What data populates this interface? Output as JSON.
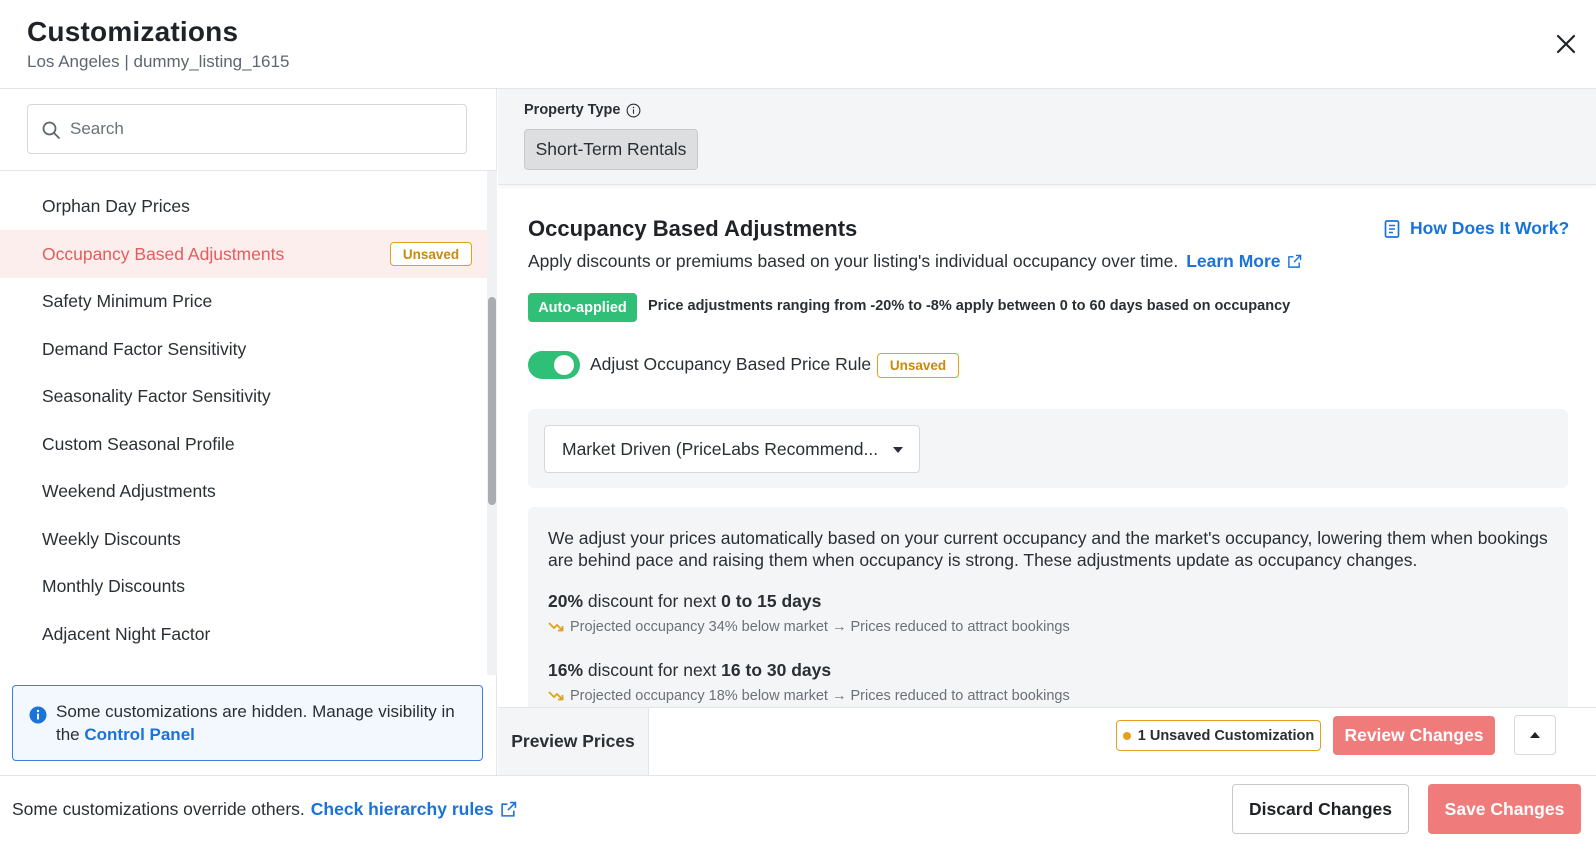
{
  "header": {
    "title": "Customizations",
    "subtitle": "Los Angeles | dummy_listing_1615"
  },
  "search": {
    "placeholder": "Search",
    "value": ""
  },
  "sidebar": {
    "items": [
      {
        "label": "Orphan Day Prices"
      },
      {
        "label": "Occupancy Based Adjustments",
        "badge": "Unsaved",
        "active": true
      },
      {
        "label": "Safety Minimum Price"
      },
      {
        "label": "Demand Factor Sensitivity"
      },
      {
        "label": "Seasonality Factor Sensitivity"
      },
      {
        "label": "Custom Seasonal Profile"
      },
      {
        "label": "Weekend Adjustments"
      },
      {
        "label": "Weekly Discounts"
      },
      {
        "label": "Monthly Discounts"
      },
      {
        "label": "Adjacent Night Factor"
      }
    ],
    "info": {
      "text": "Some customizations are hidden. Manage visibility in the ",
      "link": "Control Panel"
    }
  },
  "property": {
    "label": "Property Type",
    "value": "Short-Term Rentals"
  },
  "section": {
    "title": "Occupancy Based Adjustments",
    "how_link": "How Does It Work?",
    "description": "Apply discounts or premiums based on your listing's individual occupancy over time.",
    "learn_more": "Learn More",
    "auto_badge": "Auto-applied",
    "auto_text": "Price adjustments ranging from -20% to -8% apply between 0 to 60 days based on occupancy",
    "toggle_label": "Adjust Occupancy Based Price Rule",
    "toggle_on": true,
    "toggle_badge": "Unsaved",
    "dropdown_value": "Market Driven (PriceLabs Recommend...",
    "details_desc": "We adjust your prices automatically based on your current occupancy and the market's occupancy, lowering them when bookings are behind pace and raising them when occupancy is strong. These adjustments update as occupancy changes.",
    "tiers": [
      {
        "pct": "20%",
        "mid": " discount for next ",
        "range": "0 to 15 days",
        "note": "Projected occupancy 34% below market → Prices reduced to attract bookings"
      },
      {
        "pct": "16%",
        "mid": " discount for next ",
        "range": "16 to 30 days",
        "note": "Projected occupancy 18% below market → Prices reduced to attract bookings"
      }
    ]
  },
  "preview_bar": {
    "preview_label": "Preview Prices",
    "unsaved_count": "1 Unsaved Customization",
    "review_label": "Review Changes"
  },
  "footer": {
    "text": "Some customizations override others.",
    "link": "Check hierarchy rules",
    "discard_label": "Discard Changes",
    "save_label": "Save Changes"
  },
  "colors": {
    "accent_red": "#ef7b7b",
    "active_text": "#e45c5c",
    "green": "#2fbf76",
    "link_blue": "#1a73d9",
    "warning": "#e3a01c"
  }
}
